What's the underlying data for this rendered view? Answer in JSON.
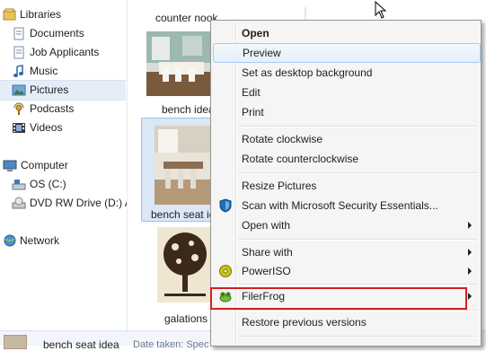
{
  "nav": {
    "libraries": "Libraries",
    "documents": "Documents",
    "job_applicants": "Job Applicants",
    "music": "Music",
    "pictures": "Pictures",
    "podcasts": "Podcasts",
    "videos": "Videos",
    "computer": "Computer",
    "os_c": "OS (C:)",
    "dvd": "DVD RW Drive (D:) A",
    "network": "Network"
  },
  "files": {
    "counter_nook": "counter nook",
    "bench_ideas": "bench idea",
    "bench_seat": "bench seat ic",
    "galations": "galations"
  },
  "details": {
    "filename": "bench seat idea",
    "meta": "Date taken: Spec"
  },
  "context_menu": {
    "open": "Open",
    "preview": "Preview",
    "set_background": "Set as desktop background",
    "edit": "Edit",
    "print": "Print",
    "rotate_cw": "Rotate clockwise",
    "rotate_ccw": "Rotate counterclockwise",
    "resize": "Resize Pictures",
    "scan": "Scan with Microsoft Security Essentials...",
    "open_with": "Open with",
    "share_with": "Share with",
    "poweriso": "PowerISO",
    "filerfrog": "FilerFrog",
    "restore": "Restore previous versions"
  },
  "icons": {
    "libraries": "libraries-icon",
    "documents": "documents-icon",
    "music": "music-icon",
    "pictures": "pictures-icon",
    "podcasts": "podcasts-icon",
    "videos": "videos-icon",
    "computer": "computer-icon",
    "drive": "drive-icon",
    "dvd": "dvd-icon",
    "network": "network-icon",
    "security": "shield-icon",
    "poweriso": "poweriso-icon",
    "filerfrog": "frog-icon"
  },
  "colors": {
    "selection": "#d9e7f7",
    "menu_bg": "#f5f5f5",
    "hover_border": "#a8cbef",
    "annotation_red": "#d32020"
  }
}
